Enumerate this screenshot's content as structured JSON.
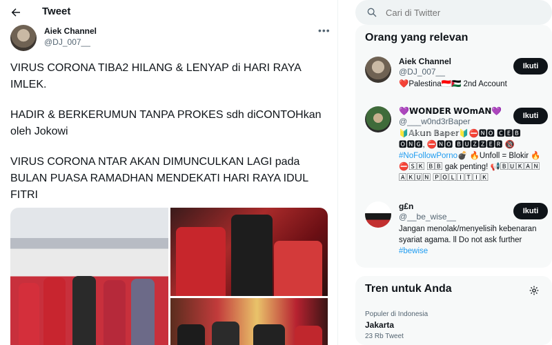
{
  "topbar": {
    "title": "Tweet"
  },
  "tweet": {
    "author_name": "Aiek Channel",
    "author_handle": "@DJ_007__",
    "more_label": "•••",
    "paragraphs": [
      "VIRUS CORONA TIBA2 HILANG & LENYAP di HARI RAYA IMLEK.",
      "HADIR & BERKERUMUN TANPA PROKES sdh diCONTOHkan oleh Jokowi",
      "VIRUS CORONA NTAR AKAN DIMUNCULKAN LAGI pada BULAN PUASA RAMADHAN MENDEKATI HARI RAYA IDUL FITRI"
    ]
  },
  "search": {
    "placeholder": "Cari di Twitter"
  },
  "relevant": {
    "title": "Orang yang relevan",
    "follow_label": "Ikuti",
    "people": [
      {
        "name": "Aiek Channel",
        "handle": "@DJ_007__",
        "bio": "❤️Palestina🇮🇩🇵🇸 2nd Account"
      },
      {
        "name": "💜𝗪𝗢𝗡𝗗𝗘𝗥 𝗪𝗢𝗺𝗔𝗡💜",
        "handle": "@___w0nd3rBaper",
        "bio_parts": [
          "🔰𝔸𝕜𝕦𝕟 𝔹𝕒𝕡𝕖𝕣🔰⛔🅽🅾 🅲🅴🅱 🅾🅽🅶, ⛔🅽🅾 🅱🆄🆉🆉🅴🆁 🔞 ",
          "#NoFollowPorno",
          "💣 🔥Unfoll = Blokir 🔥 ⛔🅂🄺 🄱🄱 gak penting! 📢🄱🅄🄺🄰🄽 🄰🄺🅄🄽 🄿🄾🄻🄸🅃🄸🄺"
        ]
      },
      {
        "name": "g£n",
        "handle": "@__be_wise__",
        "bio_parts": [
          "Jangan menolak/menyelisih kebenaran syariat agama. ll Do not ask further ",
          "#bewise"
        ]
      }
    ]
  },
  "trends": {
    "title": "Tren untuk Anda",
    "category": "Populer di Indonesia",
    "name": "Jakarta",
    "count": "23 Rb Tweet"
  }
}
